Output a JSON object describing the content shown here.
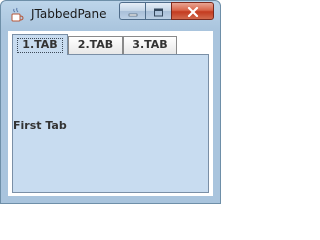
{
  "window": {
    "title": "JTabbedPane",
    "icon": "java-cup-icon",
    "controls": [
      "minimize-icon",
      "maximize-icon",
      "close-icon"
    ]
  },
  "tabs": [
    {
      "label": "1.TAB",
      "selected": true
    },
    {
      "label": "2.TAB",
      "selected": false
    },
    {
      "label": "3.TAB",
      "selected": false
    }
  ],
  "panel": {
    "text": "First Tab"
  },
  "colors": {
    "panel_background": "#c8dcf0",
    "titlebar": "#a9c4dd",
    "close_button": "#c43b20"
  }
}
